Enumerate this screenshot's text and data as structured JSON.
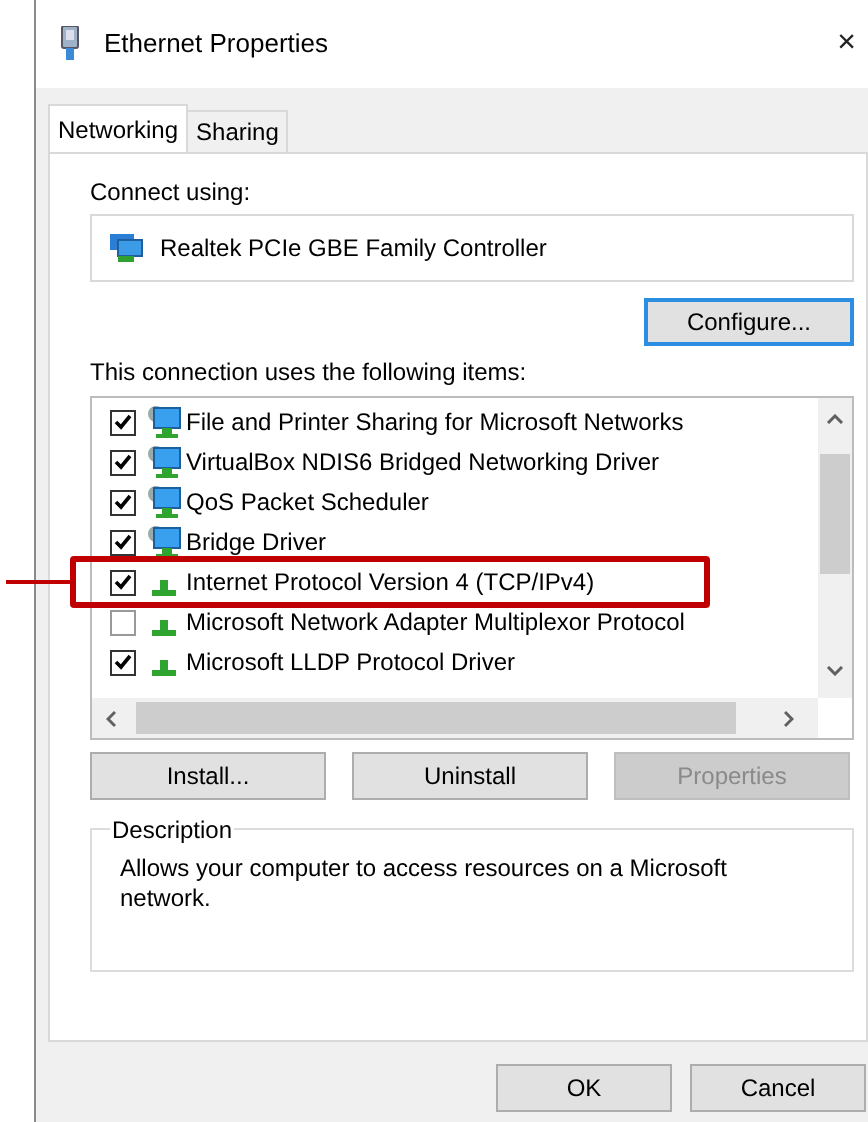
{
  "window": {
    "title": "Ethernet Properties",
    "close": "×"
  },
  "tabs": [
    {
      "label": "Networking",
      "selected": true
    },
    {
      "label": "Sharing",
      "selected": false
    }
  ],
  "connect_using": {
    "label": "Connect using:",
    "adapter": "Realtek PCIe GBE Family Controller"
  },
  "configure_button": "Configure...",
  "items_label": "This connection uses the following items:",
  "items": [
    {
      "label": "File and Printer Sharing for Microsoft Networks",
      "kind": "service",
      "checked": true,
      "highlighted": false
    },
    {
      "label": "VirtualBox NDIS6 Bridged Networking Driver",
      "kind": "service",
      "checked": true,
      "highlighted": false
    },
    {
      "label": "QoS Packet Scheduler",
      "kind": "service",
      "checked": true,
      "highlighted": false
    },
    {
      "label": "Bridge Driver",
      "kind": "service",
      "checked": true,
      "highlighted": false
    },
    {
      "label": "Internet Protocol Version 4 (TCP/IPv4)",
      "kind": "protocol",
      "checked": true,
      "highlighted": true
    },
    {
      "label": "Microsoft Network Adapter Multiplexor Protocol",
      "kind": "protocol",
      "checked": false,
      "highlighted": false
    },
    {
      "label": "Microsoft LLDP Protocol Driver",
      "kind": "protocol",
      "checked": true,
      "highlighted": false
    }
  ],
  "item_buttons": [
    {
      "label": "Install...",
      "disabled": false
    },
    {
      "label": "Uninstall",
      "disabled": false
    },
    {
      "label": "Properties",
      "disabled": true
    }
  ],
  "description": {
    "title": "Description",
    "text": "Allows your computer to access resources on a Microsoft network."
  },
  "dialog_buttons": [
    "OK",
    "Cancel"
  ]
}
